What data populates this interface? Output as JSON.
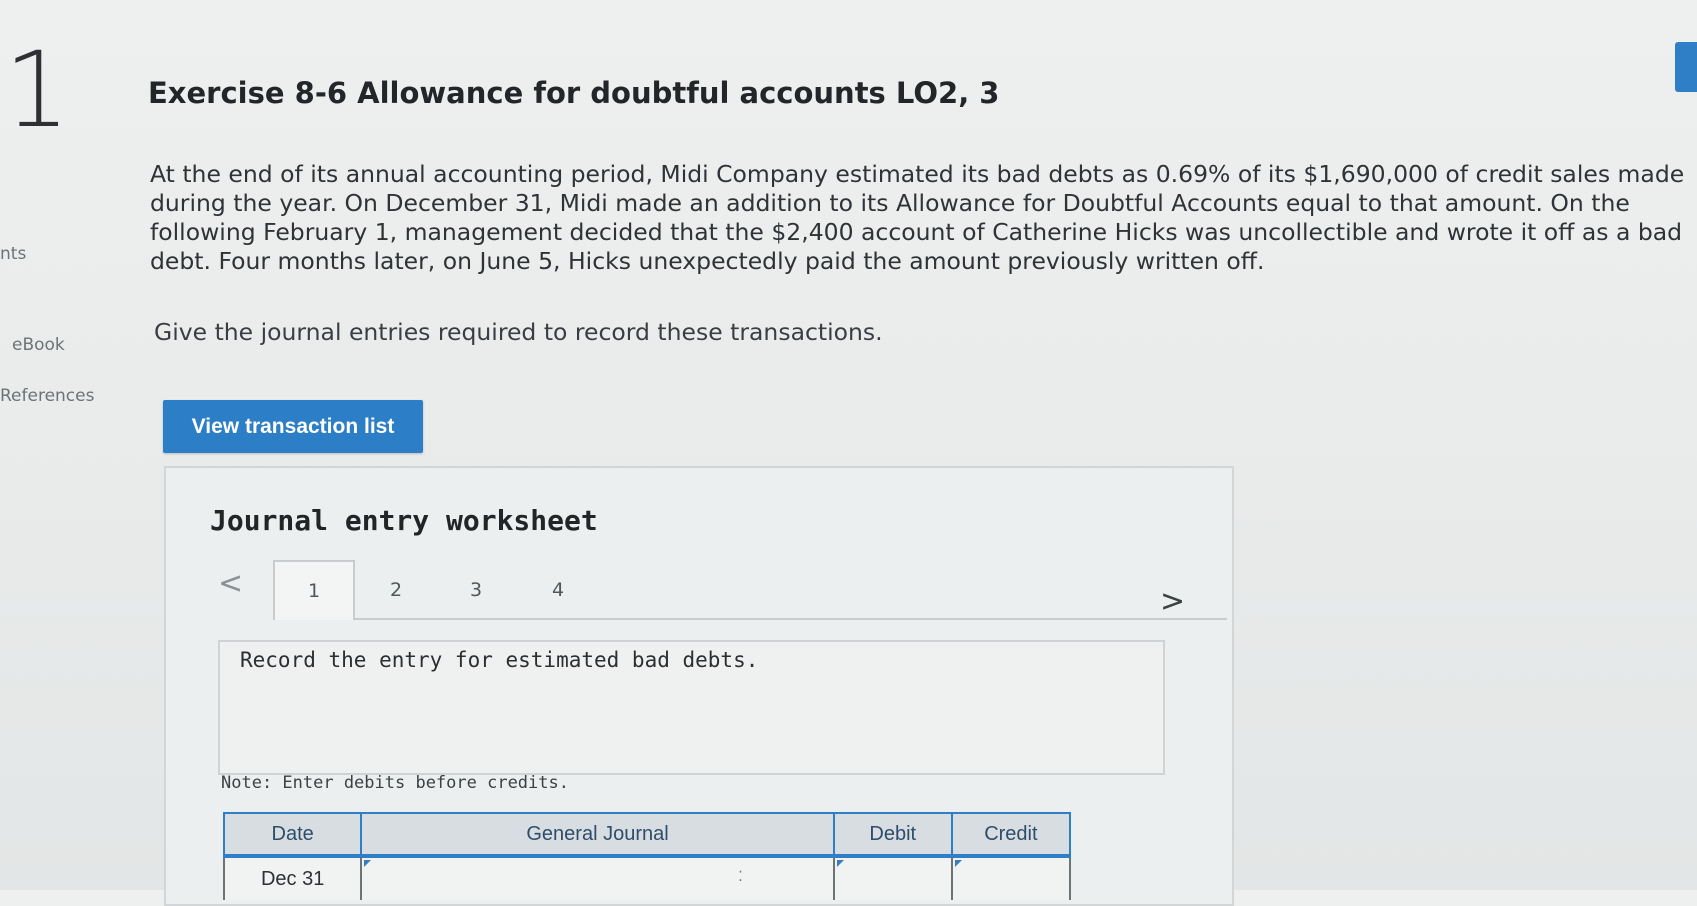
{
  "question": {
    "number": "1",
    "rail": {
      "points_label": "nts",
      "ebook_label": "eBook",
      "references_label": "References"
    },
    "title": "Exercise 8-6 Allowance for doubtful accounts LO2, 3",
    "problem_text": "At the end of its annual accounting period, Midi Company estimated its bad debts as 0.69% of its $1,690,000 of credit sales made during the year. On December 31, Midi made an addition to its Allowance for Doubtful Accounts equal to that amount. On the following February 1, management decided that the $2,400 account of Catherine Hicks was uncollectible and wrote it off as a bad debt. Four months later, on June 5, Hicks unexpectedly paid the amount previously written off.",
    "instruction": "Give the journal entries required to record these transactions.",
    "view_transaction_list_label": "View transaction list"
  },
  "worksheet": {
    "title": "Journal entry worksheet",
    "prev_label": "<",
    "next_label": ">",
    "tabs": [
      "1",
      "2",
      "3",
      "4"
    ],
    "active_tab": "1",
    "entry_instruction": "Record the entry for estimated bad debts.",
    "note": "Note: Enter debits before credits.",
    "table": {
      "headers": {
        "date": "Date",
        "general_journal": "General Journal",
        "debit": "Debit",
        "credit": "Credit"
      },
      "rows": [
        {
          "date": "Dec 31",
          "account": "",
          "debit": "",
          "credit": ""
        }
      ]
    }
  },
  "colors": {
    "accent_blue": "#2c7fc7",
    "background": "#eceeee"
  }
}
